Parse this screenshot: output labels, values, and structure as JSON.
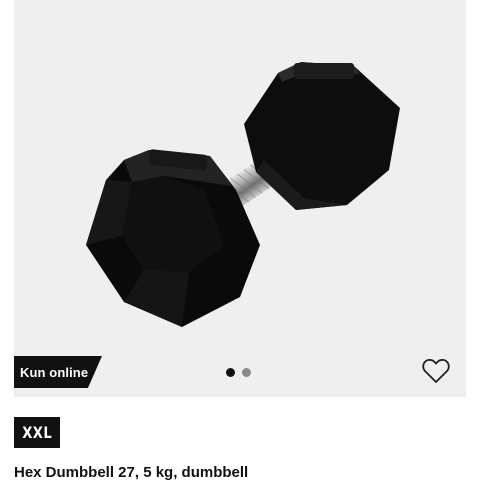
{
  "product": {
    "badge": "Kun online",
    "brand_logo": "XXL",
    "title": "Hex Dumbbell 27, 5 kg, dumbbell",
    "image": {
      "icon": "hex-dumbbell-image",
      "count": 2,
      "active_index": 0
    },
    "wishlist_icon": "heart-outline-icon"
  },
  "colors": {
    "image_background": "#efefef",
    "badge_background": "#111111",
    "logo_background": "#111111",
    "dot_active": "#111111",
    "dot_inactive": "#8b8b8b"
  }
}
